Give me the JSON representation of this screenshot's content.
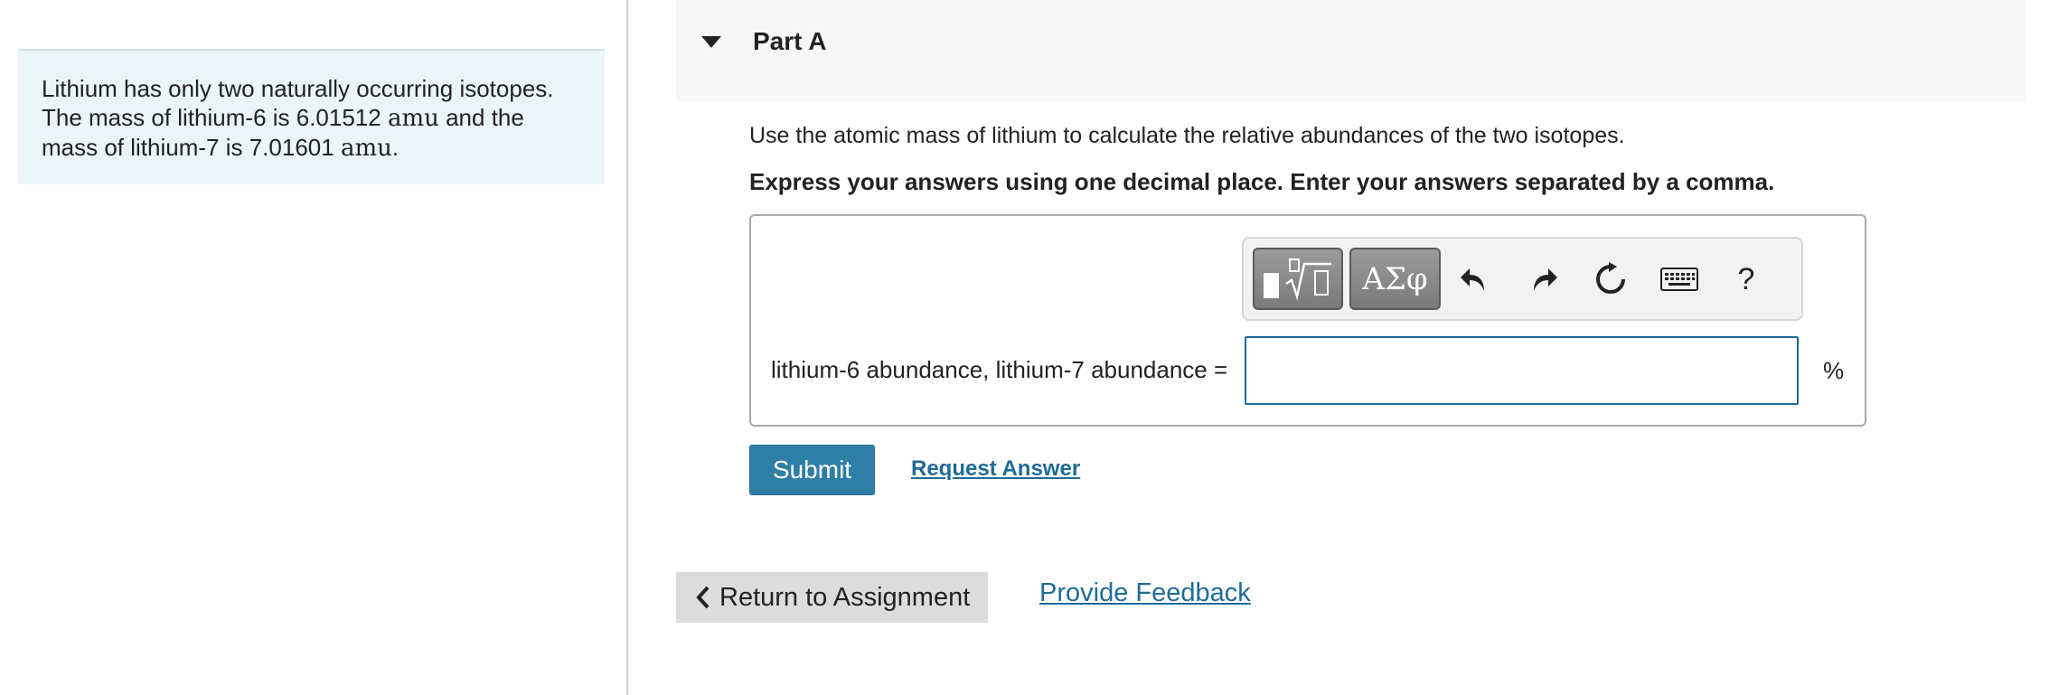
{
  "intro": {
    "line1": "Lithium has only two naturally occurring isotopes.",
    "line2_pre": "The mass of lithium-6 is 6.01512 ",
    "unit": "amu",
    "line2_post": " and the",
    "line3_pre": "mass of lithium-7 is 7.01601 ",
    "line3_post": "."
  },
  "part": {
    "title": "Part A"
  },
  "question": {
    "text": "Use the atomic mass of lithium to calculate the relative abundances of the two isotopes.",
    "instruction": "Express your answers using one decimal place. Enter your answers separated by a comma."
  },
  "toolbar": {
    "symbols_label": "ΑΣφ",
    "help_label": "?"
  },
  "answer": {
    "label": "lithium-6 abundance, lithium-7 abundance =",
    "value": "",
    "unit": "%"
  },
  "actions": {
    "submit_label": "Submit",
    "request_label": "Request Answer",
    "return_label": "Return to Assignment",
    "feedback_label": "Provide Feedback"
  },
  "colors": {
    "accent": "#2f7ea5",
    "link": "#1f6b99",
    "intro_bg": "#e9f5f7",
    "header_bg": "#f7f7f7"
  }
}
